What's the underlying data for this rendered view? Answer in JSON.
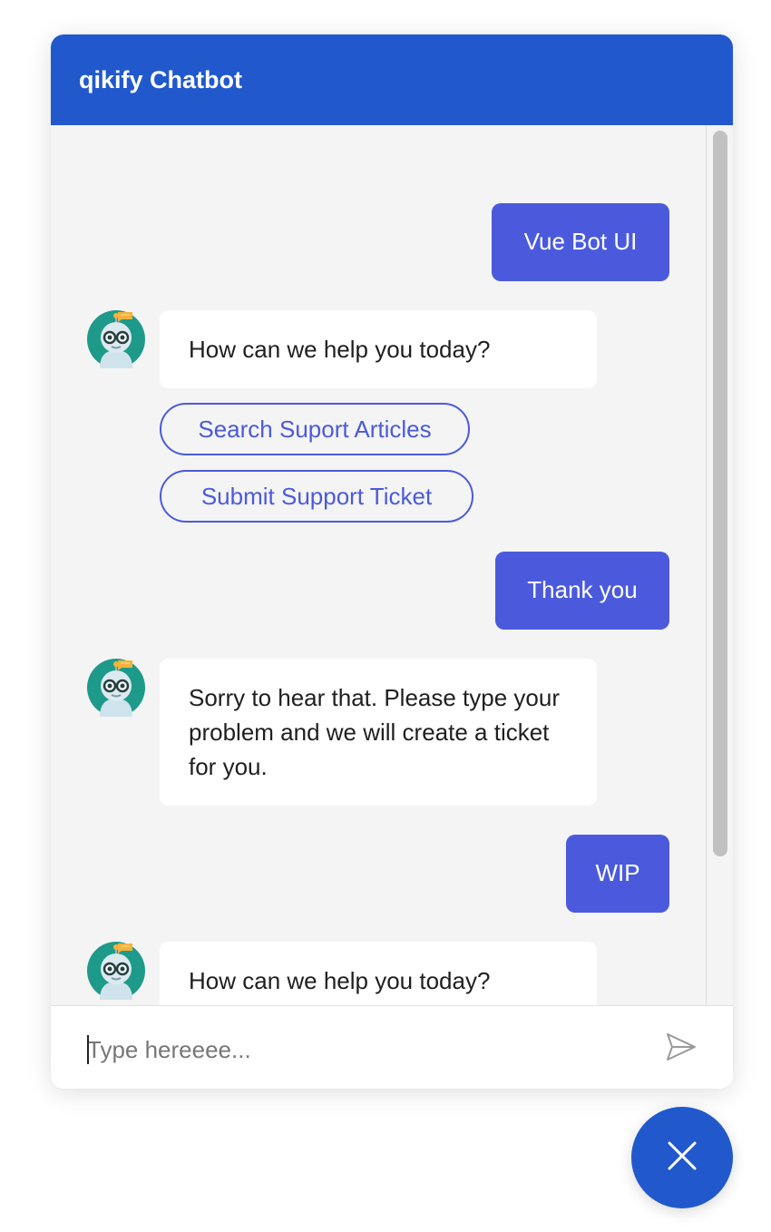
{
  "header": {
    "title": "qikify Chatbot"
  },
  "messages": [
    {
      "from": "user",
      "text": "Vue Bot UI"
    },
    {
      "from": "bot",
      "text": "How can we help you today?"
    },
    {
      "from": "user",
      "text": "Thank you"
    },
    {
      "from": "bot",
      "text": "Sorry to hear that. Please type your problem and we will create a ticket for you."
    },
    {
      "from": "user",
      "text": "WIP"
    },
    {
      "from": "bot",
      "text": "How can we help you today?"
    }
  ],
  "options": [
    {
      "label": "Search Suport Articles"
    },
    {
      "label": "Submit Support Ticket"
    }
  ],
  "input": {
    "placeholder": "Type hereeee...",
    "value": ""
  },
  "icons": {
    "avatar": "robot-avatar-icon",
    "send": "send-icon",
    "close": "close-icon"
  },
  "colors": {
    "header": "#2159cd",
    "user_bubble": "#4b5adc",
    "bot_bubble": "#ffffff",
    "option_border": "#4b5adc",
    "background": "#f4f4f4",
    "avatar_teal": "#1e9a8a"
  }
}
